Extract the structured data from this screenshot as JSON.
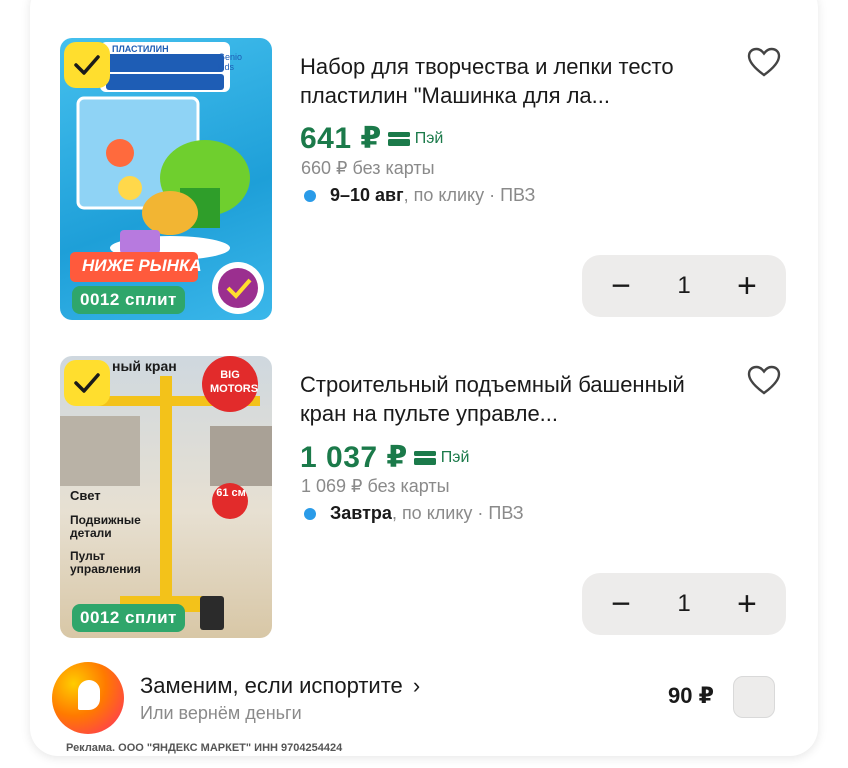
{
  "products": [
    {
      "selected": true,
      "image_badge_top": "ПЛАСТИЛИН",
      "image_brand": "Genio kids",
      "image_lower_badge": "НИЖЕ РЫНКА",
      "split_badge": "0012 сплит",
      "title": "Набор для творчества и лепки тесто пластилин \"Машинка для ла...",
      "price": "641 ₽",
      "pay_label": "Пэй",
      "old_price": "660 ₽ без карты",
      "delivery_date": "9–10 авг",
      "delivery_rest": ", по клику · ПВЗ",
      "quantity": "1"
    },
    {
      "selected": true,
      "image_badge_top": "ный кран",
      "image_brand": "BIG MOTORS",
      "image_features": [
        "Свет",
        "Подвижные детали",
        "Пульт управления"
      ],
      "image_size": "61 см",
      "split_badge": "0012 сплит",
      "title": "Строительный подъемный башенный кран на пульте управле...",
      "price": "1 037 ₽",
      "pay_label": "Пэй",
      "old_price": "1 069 ₽ без карты",
      "delivery_date": "Завтра",
      "delivery_rest": ", по клику · ПВЗ",
      "quantity": "1"
    }
  ],
  "promo": {
    "title": "Заменим, если испортите",
    "chevron": "›",
    "subtitle": "Или вернём деньги",
    "price": "90 ₽"
  },
  "ad_note": "Реклама. ООО \"ЯНДЕКС МАРКЕТ\" ИНН 9704254424",
  "colors": {
    "price_green": "#1b7a4a",
    "badge_yellow": "#ffde2e",
    "split_green": "#2fa66b",
    "delivery_dot": "#2a9be8",
    "stepper_bg": "#edeceb"
  },
  "icons": {
    "favorite": "heart-outline-icon",
    "check": "checkmark-icon",
    "pay": "card-icon",
    "minus": "minus-icon",
    "plus": "plus-icon"
  }
}
